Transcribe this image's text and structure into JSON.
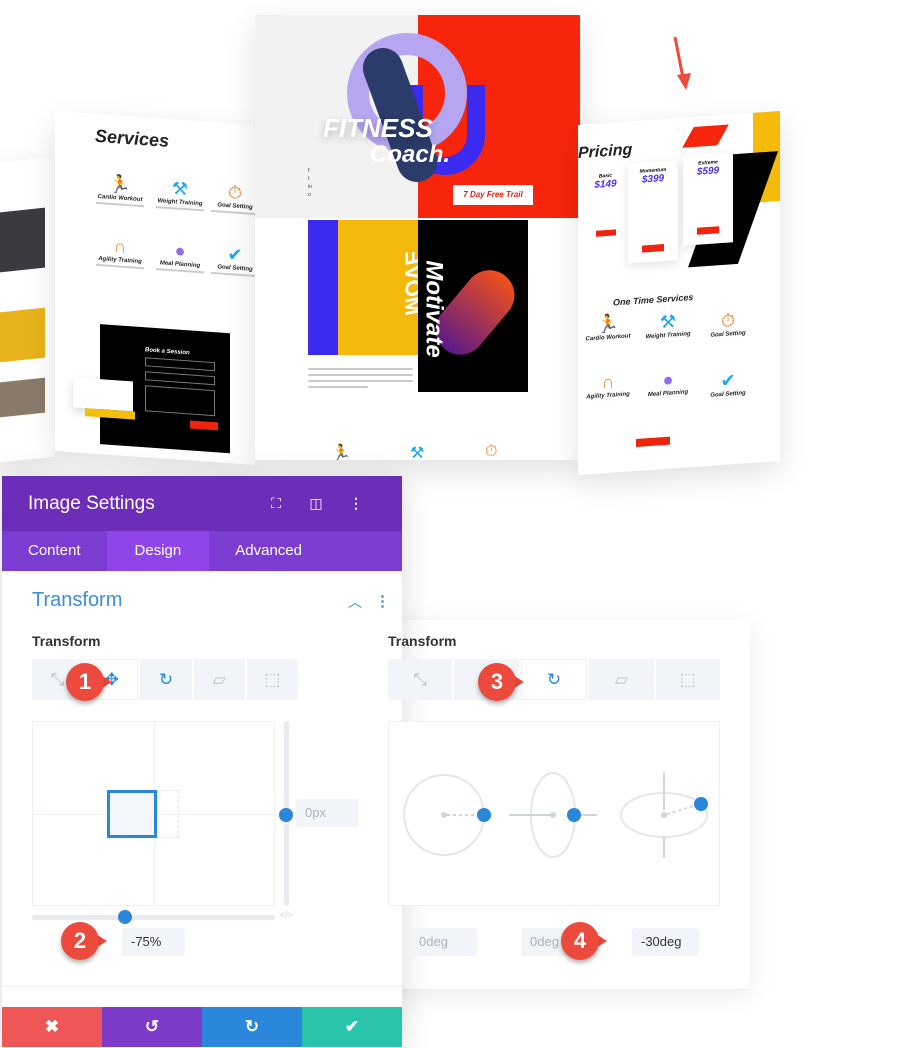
{
  "mockups": {
    "services_page": {
      "title": "Services",
      "items": [
        {
          "label": "Cardio Workout",
          "icon": "running-icon",
          "color": "#7b5cf0"
        },
        {
          "label": "Weight Training",
          "icon": "dumbbell-icon",
          "color": "#1fa6e8"
        },
        {
          "label": "Goal Setting",
          "icon": "stopwatch-icon",
          "color": "#f0782a"
        },
        {
          "label": "Agility Training",
          "icon": "jump-rope-icon",
          "color": "#f0923a"
        },
        {
          "label": "Meal Planning",
          "icon": "apple-icon",
          "color": "#8f6cf0"
        },
        {
          "label": "Goal Setting",
          "icon": "checkmark-icon",
          "color": "#1fa6e8"
        }
      ],
      "form_title": "Book a Session"
    },
    "hero_page": {
      "title_1": "FITNESS",
      "title_2": "Coach.",
      "cta": "7 Day Free Trail",
      "move": "MOVE",
      "motivate": "Motivate"
    },
    "pricing_page": {
      "title": "Pricing",
      "plans": [
        {
          "name": "Basic",
          "price": "$149"
        },
        {
          "name": "Momentum",
          "price": "$399"
        },
        {
          "name": "Extreme",
          "price": "$599"
        }
      ],
      "one_time_title": "One Time Services",
      "items": [
        "Cardio Workout",
        "Weight Training",
        "Goal Setting",
        "Agility Training",
        "Meal Planning",
        "Goal Setting"
      ]
    }
  },
  "panel": {
    "title": "Image Settings",
    "header_icons": [
      "fullscreen-icon",
      "split-view-icon",
      "more-vertical-icon"
    ],
    "tabs": [
      {
        "label": "Content",
        "active": false
      },
      {
        "label": "Design",
        "active": true
      },
      {
        "label": "Advanced",
        "active": false
      }
    ],
    "section_title": "Transform",
    "left": {
      "label": "Transform",
      "active_tool": "translate",
      "y_value": "0px",
      "x_value": "-75%"
    },
    "right": {
      "label": "Transform",
      "active_tool": "rotate",
      "rotate_values": [
        "0deg",
        "0deg",
        "-30deg"
      ]
    },
    "footer": {
      "cancel": "✖",
      "undo": "↺",
      "redo": "↻",
      "save": "✔"
    },
    "colors": {
      "header": "#6c2eb9",
      "tabs": "#7b3dd1",
      "accent": "#2b87da",
      "cancel": "#ef5656",
      "undo": "#7c3bc9",
      "redo": "#2b87da",
      "save": "#29c4a9"
    }
  },
  "badges": [
    "1",
    "2",
    "3",
    "4"
  ]
}
